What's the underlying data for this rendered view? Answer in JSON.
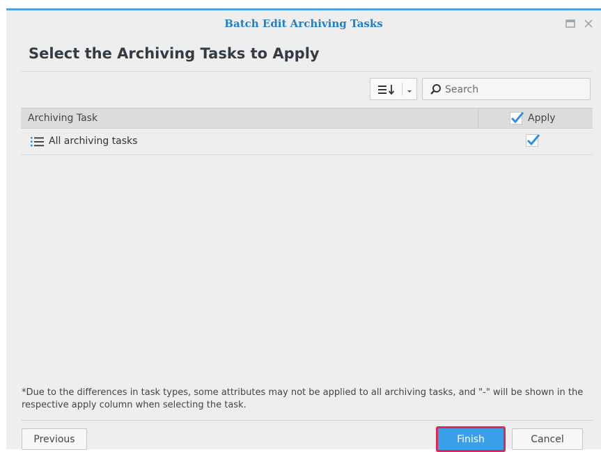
{
  "window": {
    "title": "Batch Edit Archiving Tasks"
  },
  "page": {
    "title": "Select the Archiving Tasks to Apply"
  },
  "toolbar": {
    "sort_icon": "sort-icon",
    "search_placeholder": "Search"
  },
  "grid": {
    "columns": {
      "task": "Archiving Task",
      "apply": "Apply"
    },
    "header_apply_checked": true,
    "rows": [
      {
        "label": "All archiving tasks",
        "apply": true,
        "icon": "list-icon"
      }
    ]
  },
  "note": "*Due to the differences in task types, some attributes may not be applied to all archiving tasks, and \"-\" will be shown in the respective apply column when selecting the task.",
  "footer": {
    "previous": "Previous",
    "finish": "Finish",
    "cancel": "Cancel"
  },
  "colors": {
    "accent": "#3a9fe9",
    "title": "#1f7fc8",
    "highlight_border": "#e0254e"
  }
}
